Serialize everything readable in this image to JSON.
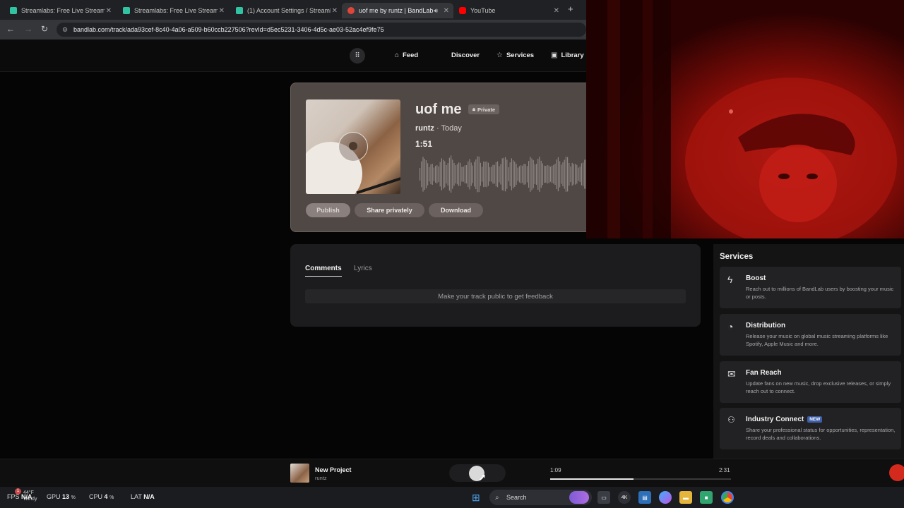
{
  "browser": {
    "tabs": [
      {
        "title": "Streamlabs: Free Live Streaming",
        "favicon_color": "#31c3a2"
      },
      {
        "title": "Streamlabs: Free Live Streaming",
        "favicon_color": "#31c3a2"
      },
      {
        "title": "(1) Account Settings / Streamlab",
        "favicon_color": "#31c3a2"
      },
      {
        "title": "uof me by runtz | BandLab",
        "favicon_color": "#e0453a"
      },
      {
        "title": "YouTube",
        "favicon_color": "#ff0000"
      }
    ],
    "active_tab_index": 3,
    "url": "bandlab.com/track/ada93cef-8c40-4a06-a509-b60ccb227506?revId=d5ec5231-3406-4d5c-ae03-52ac4ef9fe75"
  },
  "sitenav": {
    "items": [
      {
        "label": "Feed",
        "icon": "home-icon"
      },
      {
        "label": "Discover",
        "icon": ""
      },
      {
        "label": "Services",
        "icon": "star-icon"
      },
      {
        "label": "Library",
        "icon": "library-icon"
      }
    ]
  },
  "track": {
    "title": "uof me",
    "privacy_badge": "Private",
    "artist": "runtz",
    "posted": "· Today",
    "duration": "1:51",
    "buttons": {
      "publish": "Publish",
      "share": "Share privately",
      "download": "Download"
    }
  },
  "comments": {
    "tabs": [
      "Comments",
      "Lyrics"
    ],
    "active_tab": "Comments",
    "empty_message": "Make your track public to get feedback"
  },
  "services": {
    "heading": "Services",
    "items": [
      {
        "name": "Boost",
        "icon": "bolt-icon",
        "badge": "",
        "description": "Reach out to millions of BandLab users by boosting your music or posts."
      },
      {
        "name": "Distribution",
        "icon": "distribution-icon",
        "badge": "",
        "description": "Release your music on global music streaming platforms like Spotify, Apple Music and more."
      },
      {
        "name": "Fan Reach",
        "icon": "envelope-icon",
        "badge": "",
        "description": "Update fans on new music, drop exclusive releases, or simply reach out to connect."
      },
      {
        "name": "Industry Connect",
        "icon": "people-icon",
        "badge": "NEW",
        "description": "Share your professional status for opportunities, representation, record deals and collaborations."
      }
    ]
  },
  "player": {
    "project_name": "New Project",
    "artist": "runtz",
    "current_time": "1:09",
    "total_time": "2:31",
    "progress_fraction": 0.46
  },
  "taskbar": {
    "fps_label": "FPS",
    "fps_value": "N/A",
    "gpu_label": "GPU",
    "gpu_value": "13",
    "cpu_label": "CPU",
    "cpu_value": "4",
    "percent_unit": "%",
    "lat_label": "LAT",
    "lat_value": "N/A",
    "weather_temp": "44°F",
    "weather_desc": "Windy",
    "notification_count": "1",
    "search_placeholder": "Search",
    "meter_badge": "4K"
  }
}
